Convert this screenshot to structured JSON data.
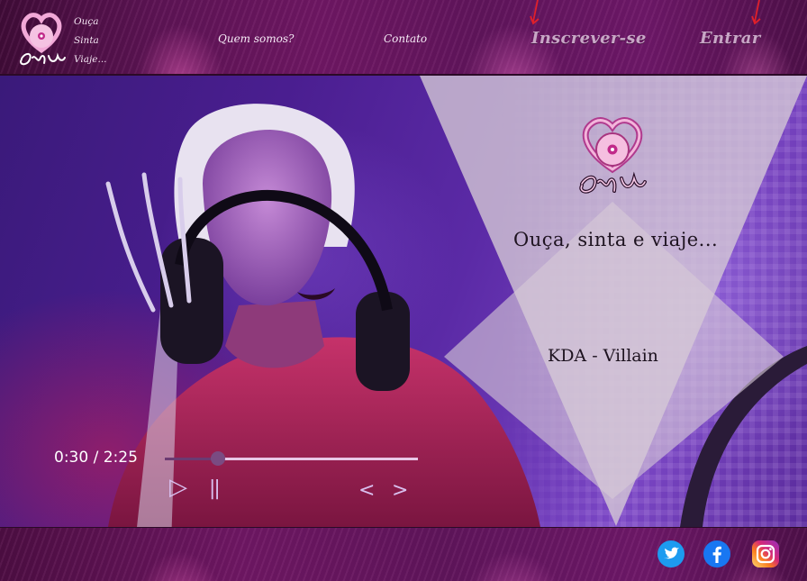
{
  "header": {
    "tagline": [
      "Ouça",
      "Sinta",
      "Viaje..."
    ],
    "nav": {
      "about": "Quem somos?",
      "contact": "Contato",
      "signup": "Inscrever-se",
      "login": "Entrar"
    }
  },
  "logo": {
    "text": "Elyn"
  },
  "hero": {
    "slogan": "Ouça, sinta e viaje...",
    "track_title": "KDA - Villain"
  },
  "player": {
    "time": "0:30 / 2:25",
    "progress_fraction": 0.21,
    "play_glyph": "▷",
    "pause_glyph": "||",
    "prev_glyph": "<",
    "next_glyph": ">"
  },
  "footer": {
    "social": [
      {
        "name": "twitter-icon",
        "color": "#1d9bf0"
      },
      {
        "name": "facebook-icon",
        "color": "#1877f2"
      },
      {
        "name": "instagram-icon",
        "color": "#d62976"
      }
    ]
  },
  "colors": {
    "accent_pink": "#e8c6e6",
    "header_bg": "#5a1352",
    "triangle": "#d6cad6",
    "arrow_red": "#e0202a"
  }
}
